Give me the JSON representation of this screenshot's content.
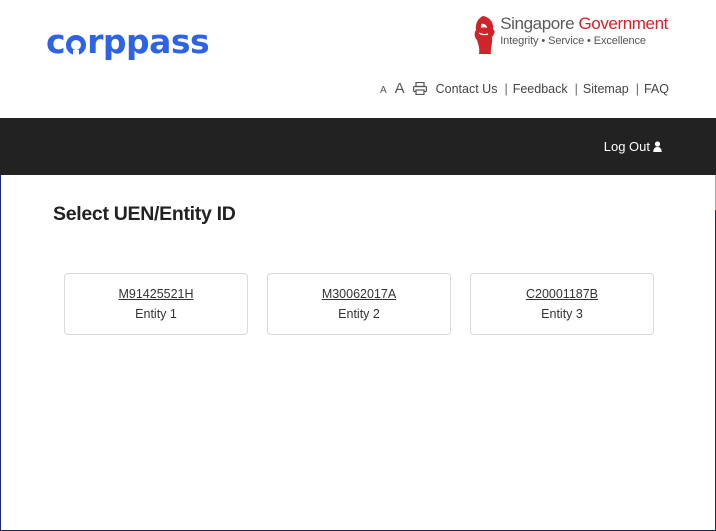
{
  "brand": {
    "logo_prefix": "c",
    "logo_suffix": "rppass",
    "logo_color": "#2f63e6"
  },
  "gov": {
    "title_part1": "Singapore ",
    "title_part2": "Government",
    "tagline": "Integrity  •  Service  •  Excellence",
    "accent": "#d1232a"
  },
  "utility": {
    "font_small": "A",
    "font_large": "A",
    "print_icon": "printer-icon",
    "links": [
      "Contact Us",
      "Feedback",
      "Sitemap",
      "FAQ"
    ]
  },
  "nav": {
    "logout_label": "Log Out",
    "logout_icon": "user-icon",
    "bar_color": "#222222"
  },
  "main": {
    "title": "Select UEN/Entity ID",
    "entities": [
      {
        "uen": "M91425521H",
        "name": "Entity 1"
      },
      {
        "uen": "M30062017A",
        "name": "Entity 2"
      },
      {
        "uen": "C20001187B",
        "name": "Entity 3"
      }
    ]
  }
}
